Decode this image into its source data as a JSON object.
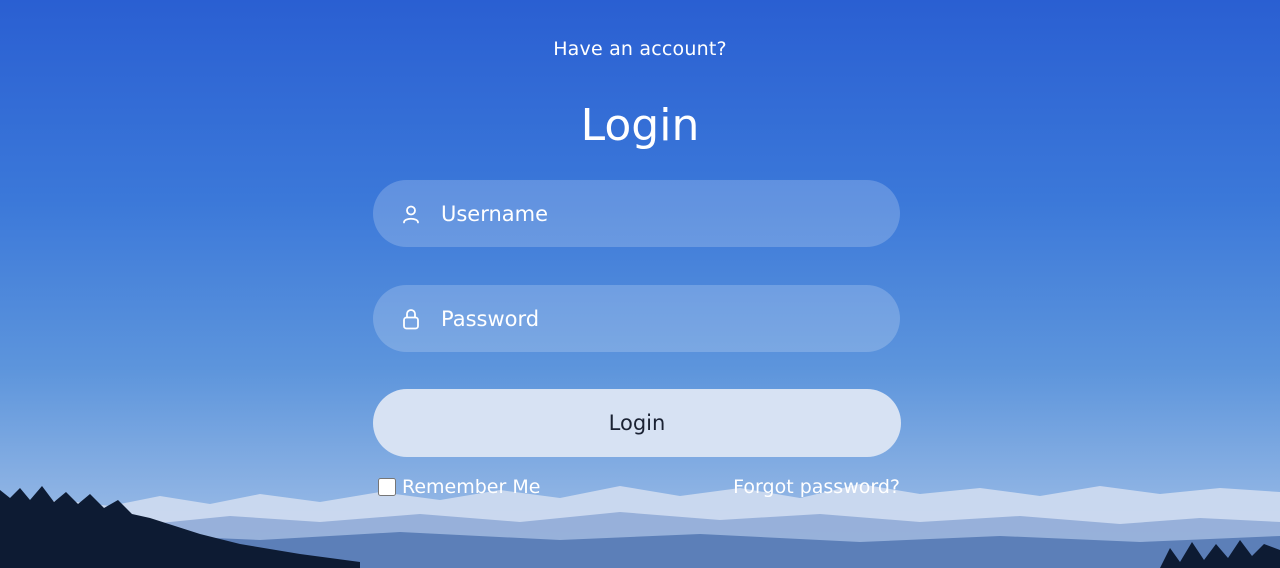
{
  "header": {
    "prompt": "Have an account?",
    "title": "Login"
  },
  "form": {
    "username": {
      "placeholder": "Username",
      "value": "",
      "icon": "user-icon"
    },
    "password": {
      "placeholder": "Password",
      "value": "",
      "icon": "lock-icon"
    },
    "submit_label": "Login",
    "remember_label": "Remember Me",
    "remember_checked": false,
    "forgot_label": "Forgot password?"
  },
  "colors": {
    "background_top": "#2a5fd2",
    "background_bottom": "#a9c4e8",
    "button": "#d7e2f3",
    "text": "#ffffff"
  }
}
